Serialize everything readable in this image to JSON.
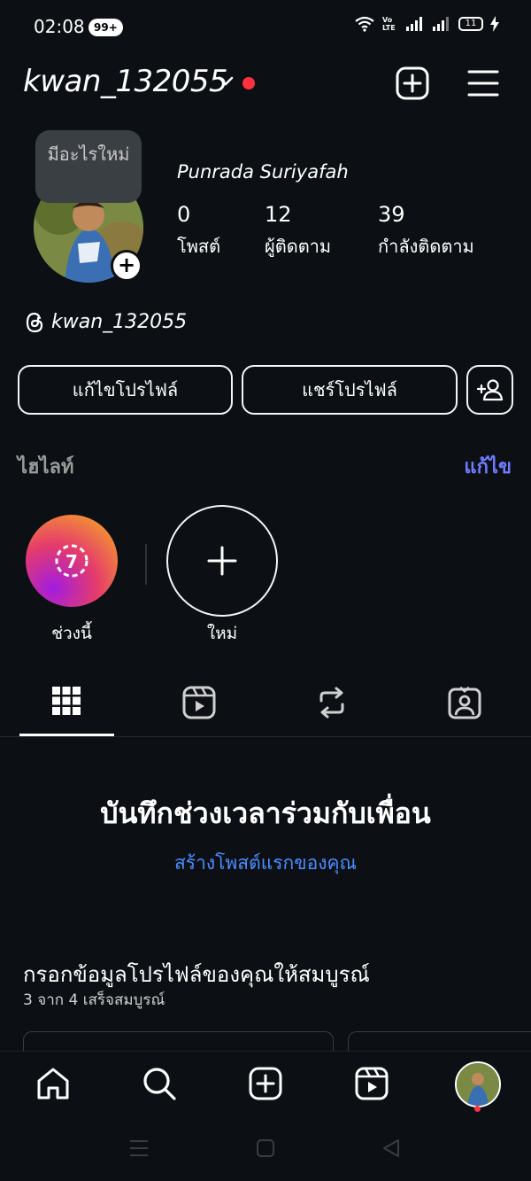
{
  "status": {
    "time": "02:08",
    "notif_badge": "99+",
    "net_label": "Vo LTE",
    "battery": "11"
  },
  "header": {
    "username": "kwan_132055",
    "accent_color": "#ff3040"
  },
  "profile": {
    "tooltip": "มีอะไรใหม่",
    "full_name": "Punrada Suriyafah",
    "stats": [
      {
        "value": "0",
        "label": "โพสต์"
      },
      {
        "value": "12",
        "label": "ผู้ติดตาม"
      },
      {
        "value": "39",
        "label": "กำลังติดตาม"
      }
    ],
    "threads_handle": "kwan_132055"
  },
  "buttons": {
    "edit_profile": "แก้ไขโปรไฟล์",
    "share_profile": "แชร์โปรไฟล์"
  },
  "highlights": {
    "title": "ไฮไลท์",
    "edit": "แก้ไข",
    "edit_color": "#6f7bff",
    "items": [
      {
        "label": "ช่วงนี้",
        "badge": "7"
      },
      {
        "label": "ใหม่"
      }
    ]
  },
  "tabs": [
    "grid-icon",
    "reels-icon",
    "reposts-icon",
    "tagged-icon"
  ],
  "empty_state": {
    "title": "บันทึกช่วงเวลาร่วมกับเพื่อน",
    "link": "สร้างโพสต์แรกของคุณ",
    "link_color": "#4a8dff"
  },
  "complete_profile": {
    "title": "กรอกข้อมูลโปรไฟล์ของคุณให้สมบูรณ์",
    "progress_count": "3",
    "progress_word": "จาก",
    "progress_total": "4",
    "progress_status": "เสร็จสมบูรณ์"
  },
  "bottom_nav": [
    "home-icon",
    "search-icon",
    "create-icon",
    "reels-icon",
    "profile-avatar"
  ]
}
